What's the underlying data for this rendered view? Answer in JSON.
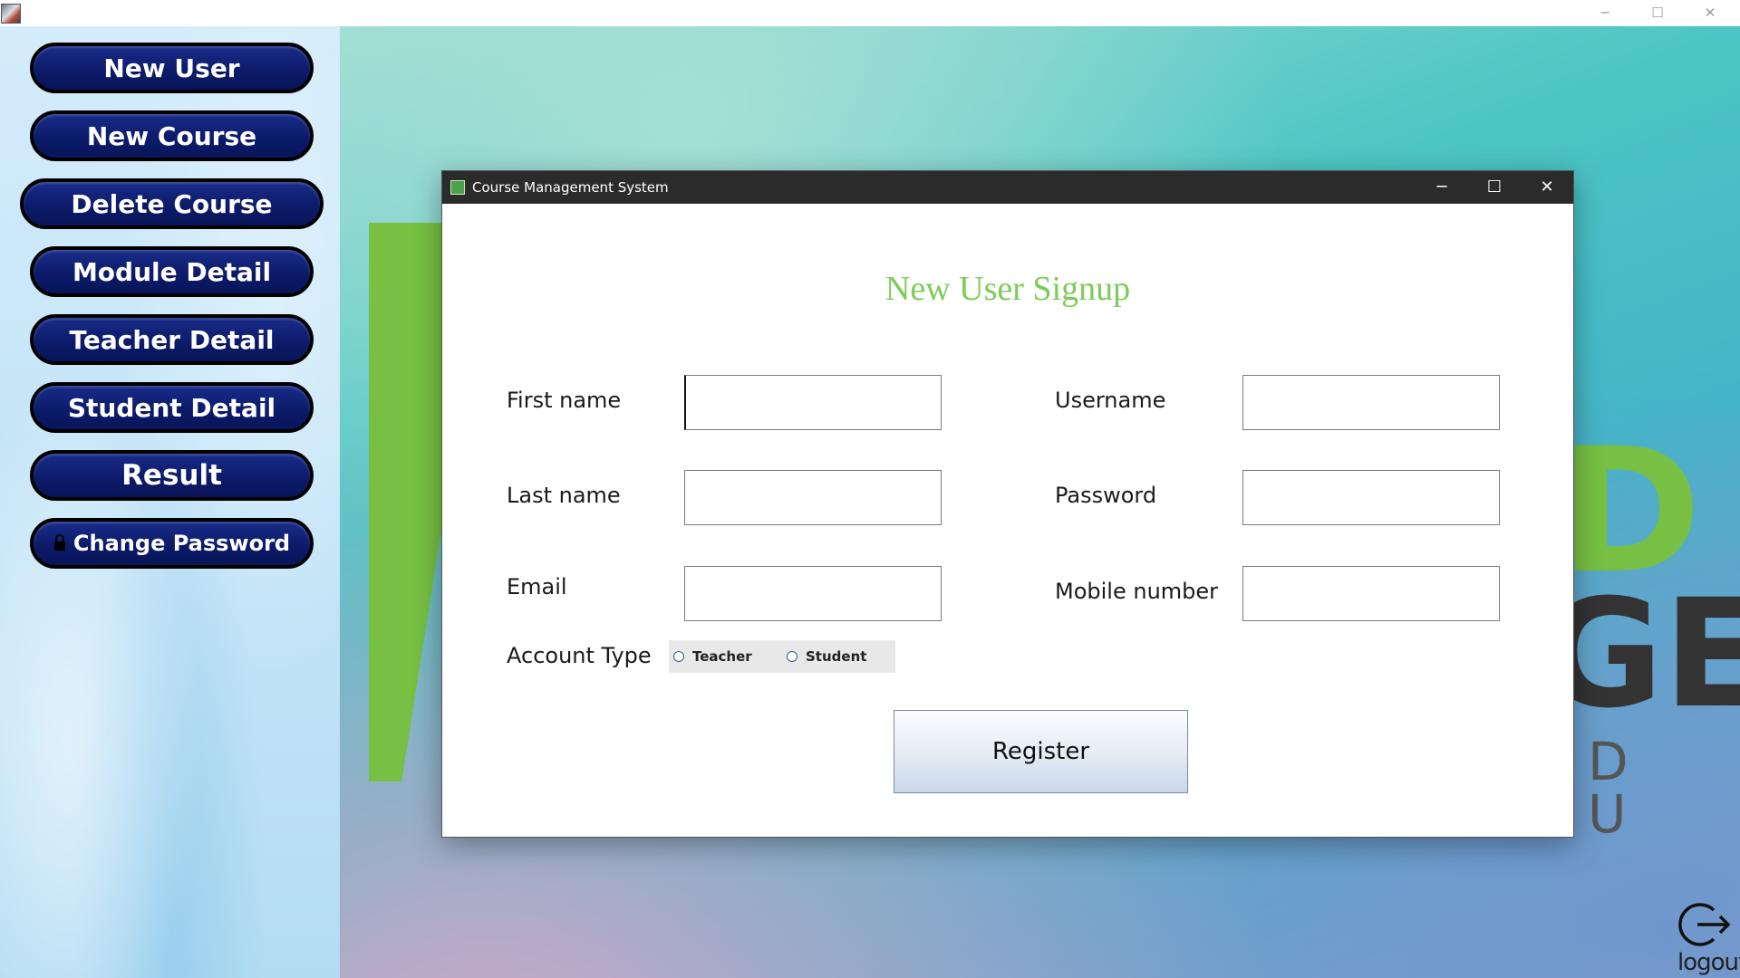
{
  "window": {
    "controls": {
      "minimize": "─",
      "maximize": "☐",
      "close": "✕"
    }
  },
  "sidebar": {
    "items": [
      {
        "label": "New User"
      },
      {
        "label": "New Course"
      },
      {
        "label": "Delete Course"
      },
      {
        "label": "Module Detail"
      },
      {
        "label": "Teacher Detail"
      },
      {
        "label": "Student Detail"
      },
      {
        "label": "Result"
      },
      {
        "label": "Change Password",
        "icon": "lock-icon"
      }
    ]
  },
  "background": {
    "logo_letters_1": "D",
    "logo_letters_2": "GE",
    "logo_letters_3": "D U",
    "logout_label": "logout",
    "colors": {
      "green": "#77c043",
      "dark": "#333333"
    }
  },
  "dialog": {
    "title": "Course Management System",
    "controls": {
      "minimize": "─",
      "maximize": "☐",
      "close": "✕"
    },
    "heading": "New User Signup",
    "fields": {
      "first_name": {
        "label": "First name",
        "value": ""
      },
      "last_name": {
        "label": "Last name",
        "value": ""
      },
      "email": {
        "label": "Email",
        "value": ""
      },
      "username": {
        "label": "Username",
        "value": ""
      },
      "password": {
        "label": "Password",
        "value": ""
      },
      "mobile": {
        "label": "Mobile number",
        "value": ""
      }
    },
    "account_type": {
      "label": "Account Type",
      "options": [
        "Teacher",
        "Student"
      ],
      "selected": null
    },
    "register_label": "Register",
    "heading_color": "#7ccc57"
  }
}
